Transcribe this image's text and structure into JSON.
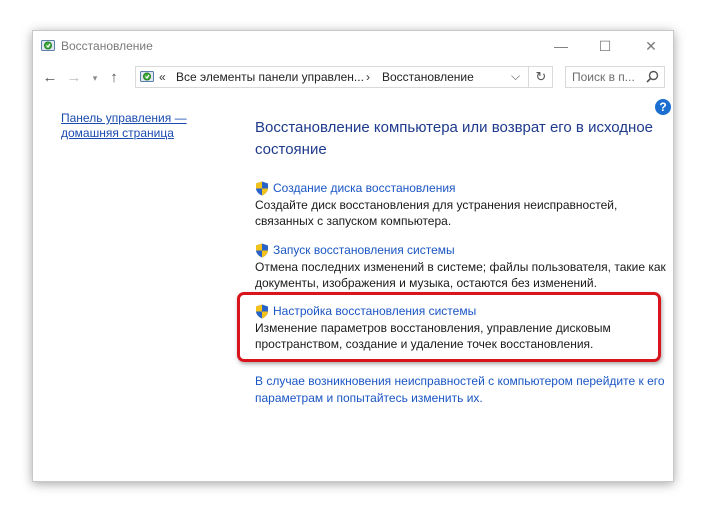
{
  "window": {
    "title": "Восстановление",
    "controls": {
      "minimize": "—",
      "maximize": "☐",
      "close": "✕"
    }
  },
  "nav": {
    "back": "←",
    "forward": "→",
    "recent": "▾",
    "up": "↑",
    "address": {
      "chevron": "«",
      "crumb1": "Все элементы панели управлен...",
      "separator": "›",
      "crumb2": "Восстановление",
      "dropdown": "⌵",
      "refresh": "↻"
    },
    "search": {
      "placeholder": "Поиск в п..."
    }
  },
  "help": {
    "label": "?"
  },
  "sidebar": {
    "home_link": "Панель управления — домашняя страница"
  },
  "main": {
    "heading": "Восстановление компьютера или возврат его в исходное состояние",
    "tasks": [
      {
        "label": "Создание диска восстановления",
        "description": "Создайте диск восстановления для устранения неисправностей, связанных с запуском компьютера."
      },
      {
        "label": "Запуск восстановления системы",
        "description": "Отмена последних изменений в системе; файлы пользователя, такие как документы, изображения и музыка, остаются без изменений."
      },
      {
        "label": "Настройка восстановления системы",
        "description": "Изменение параметров восстановления, управление дисковым пространством, создание и удаление точек восстановления."
      }
    ],
    "bottom_link": "В случае возникновения неисправностей с компьютером перейдите к его параметрам и попытайтесь изменить их."
  },
  "colors": {
    "link": "#1a56c4",
    "heading": "#1e3a8c",
    "highlight": "#d9141c",
    "shield_blue": "#2a63c8",
    "shield_yellow": "#f2c21b"
  },
  "icons": {
    "app": "recovery-icon",
    "task": "uac-shield-icon",
    "search": "search-icon"
  }
}
